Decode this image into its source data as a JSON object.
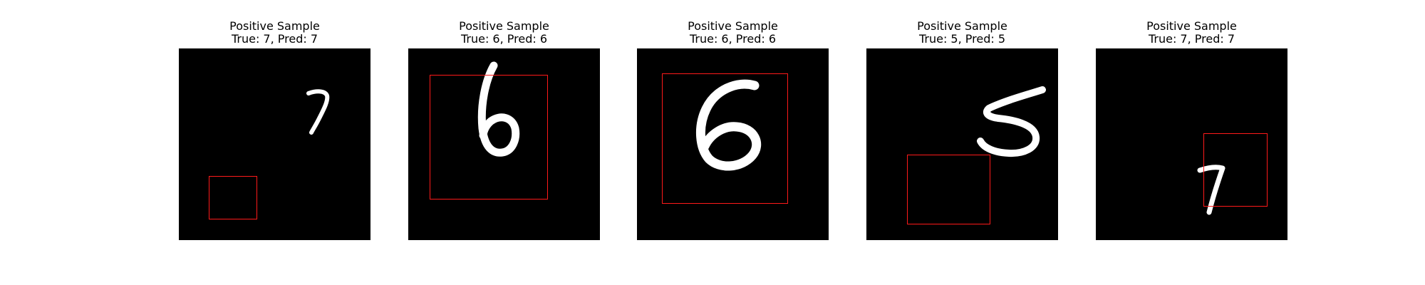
{
  "panels": [
    {
      "title": "Positive Sample",
      "subtitle": "True: 7, Pred: 7",
      "digit": "7"
    },
    {
      "title": "Positive Sample",
      "subtitle": "True: 6, Pred: 6",
      "digit": "6"
    },
    {
      "title": "Positive Sample",
      "subtitle": "True: 6, Pred: 6",
      "digit": "6"
    },
    {
      "title": "Positive Sample",
      "subtitle": "True: 5, Pred: 5",
      "digit": "5"
    },
    {
      "title": "Positive Sample",
      "subtitle": "True: 7, Pred: 7",
      "digit": "7"
    }
  ],
  "colors": {
    "background": "#000000",
    "bbox": "#ff1a1a",
    "digit": "#ffffff"
  }
}
